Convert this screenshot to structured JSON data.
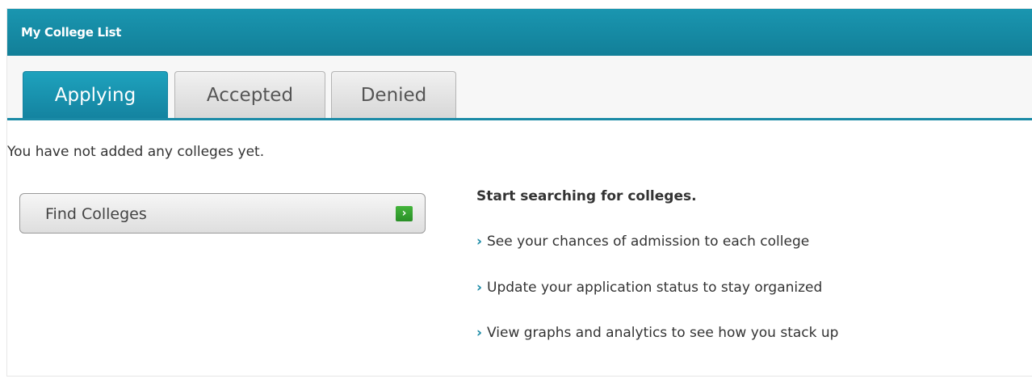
{
  "header": {
    "title": "My College List"
  },
  "tabs": [
    {
      "label": "Applying",
      "active": true
    },
    {
      "label": "Accepted",
      "active": false
    },
    {
      "label": "Denied",
      "active": false
    }
  ],
  "content": {
    "empty_message": "You have not added any colleges yet.",
    "find_button": {
      "label": "Find Colleges",
      "icon": "arrow-right-icon",
      "icon_glyph": "›",
      "icon_color": "#33a22f"
    },
    "info": {
      "heading": "Start searching for colleges.",
      "bullet": "›",
      "items": [
        "See your chances of admission to each college",
        "Update your application status to stay organized",
        "View graphs and analytics to see how you stack up"
      ]
    }
  },
  "colors": {
    "accent": "#1a8aa6",
    "header_bg": "#1790aa",
    "active_tab_text": "#ffffff",
    "inactive_tab_bg": "#e4e4e4"
  }
}
